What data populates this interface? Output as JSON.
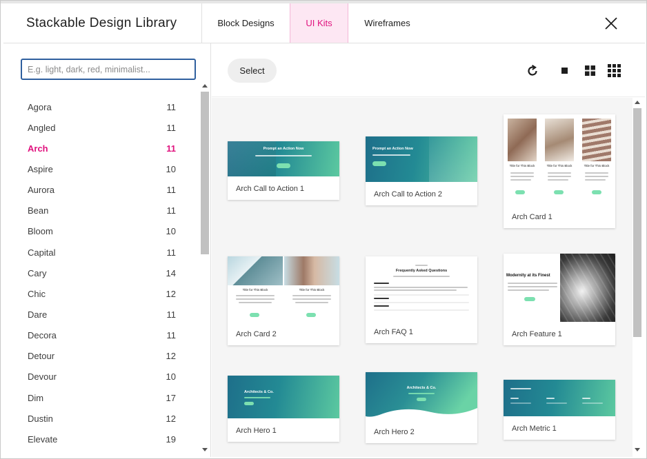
{
  "header": {
    "title": "Stackable Design Library",
    "tabs": [
      "Block Designs",
      "UI Kits",
      "Wireframes"
    ],
    "active_tab": "UI Kits"
  },
  "sidebar": {
    "search_placeholder": "E.g. light, dark, red, minimalist...",
    "active_category": "Arch",
    "categories": [
      {
        "name": "Agora",
        "count": "11"
      },
      {
        "name": "Angled",
        "count": "11"
      },
      {
        "name": "Arch",
        "count": "11"
      },
      {
        "name": "Aspire",
        "count": "10"
      },
      {
        "name": "Aurora",
        "count": "11"
      },
      {
        "name": "Bean",
        "count": "11"
      },
      {
        "name": "Bloom",
        "count": "10"
      },
      {
        "name": "Capital",
        "count": "11"
      },
      {
        "name": "Cary",
        "count": "14"
      },
      {
        "name": "Chic",
        "count": "12"
      },
      {
        "name": "Dare",
        "count": "11"
      },
      {
        "name": "Decora",
        "count": "11"
      },
      {
        "name": "Detour",
        "count": "12"
      },
      {
        "name": "Devour",
        "count": "10"
      },
      {
        "name": "Dim",
        "count": "17"
      },
      {
        "name": "Dustin",
        "count": "12"
      },
      {
        "name": "Elevate",
        "count": "19"
      }
    ]
  },
  "toolbar": {
    "select_label": "Select",
    "icons": [
      "refresh-icon",
      "single-column-icon",
      "two-column-grid-icon",
      "three-column-grid-icon"
    ]
  },
  "designs": [
    {
      "label": "Arch Call to Action 1",
      "heading": "Prompt an Action Now"
    },
    {
      "label": "Arch Call to Action 2",
      "heading": "Prompt an Action Now"
    },
    {
      "label": "Arch Card 1",
      "heading": "Title for This Block"
    },
    {
      "label": "Arch Card 2",
      "heading": "Title for This Block"
    },
    {
      "label": "Arch FAQ 1",
      "heading": "Frequently Asked Questions"
    },
    {
      "label": "Arch Feature 1",
      "heading": "Modernity at its Finest"
    },
    {
      "label": "Arch Hero 1",
      "heading": "Architects & Co."
    },
    {
      "label": "Arch Hero 2",
      "heading": "Architects & Co."
    },
    {
      "label": "Arch Metric 1",
      "heading": ""
    }
  ],
  "colors": {
    "accent": "#e0127e",
    "active_tab_bg": "#fde7f3",
    "teal_start": "#1e6f8a",
    "teal_end": "#5cc9a0",
    "search_border": "#2e5f9e"
  }
}
